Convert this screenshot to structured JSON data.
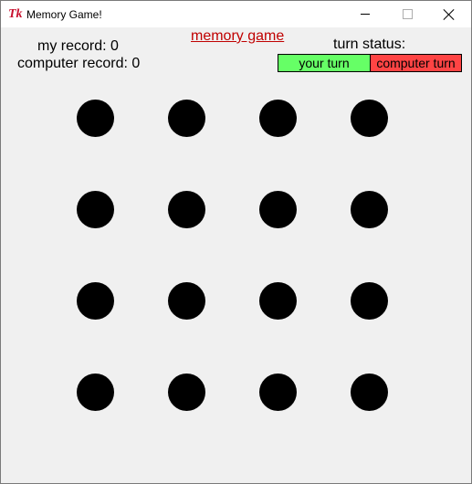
{
  "window": {
    "title": "Memory Game!",
    "logo_text": "Tk"
  },
  "header": {
    "my_record": "my record: 0",
    "computer_record": "computer record: 0",
    "game_title": "memory game",
    "turn_status_label": "turn status:",
    "your_turn_label": "your turn",
    "computer_turn_label": "computer turn"
  },
  "colors": {
    "title_link": "#c00000",
    "your_turn_bg": "#66ff66",
    "computer_turn_bg": "#ff4444",
    "dot": "#000000",
    "background": "#f0f0f0"
  },
  "board": {
    "rows": 4,
    "cols": 4,
    "dot_count": 16
  }
}
